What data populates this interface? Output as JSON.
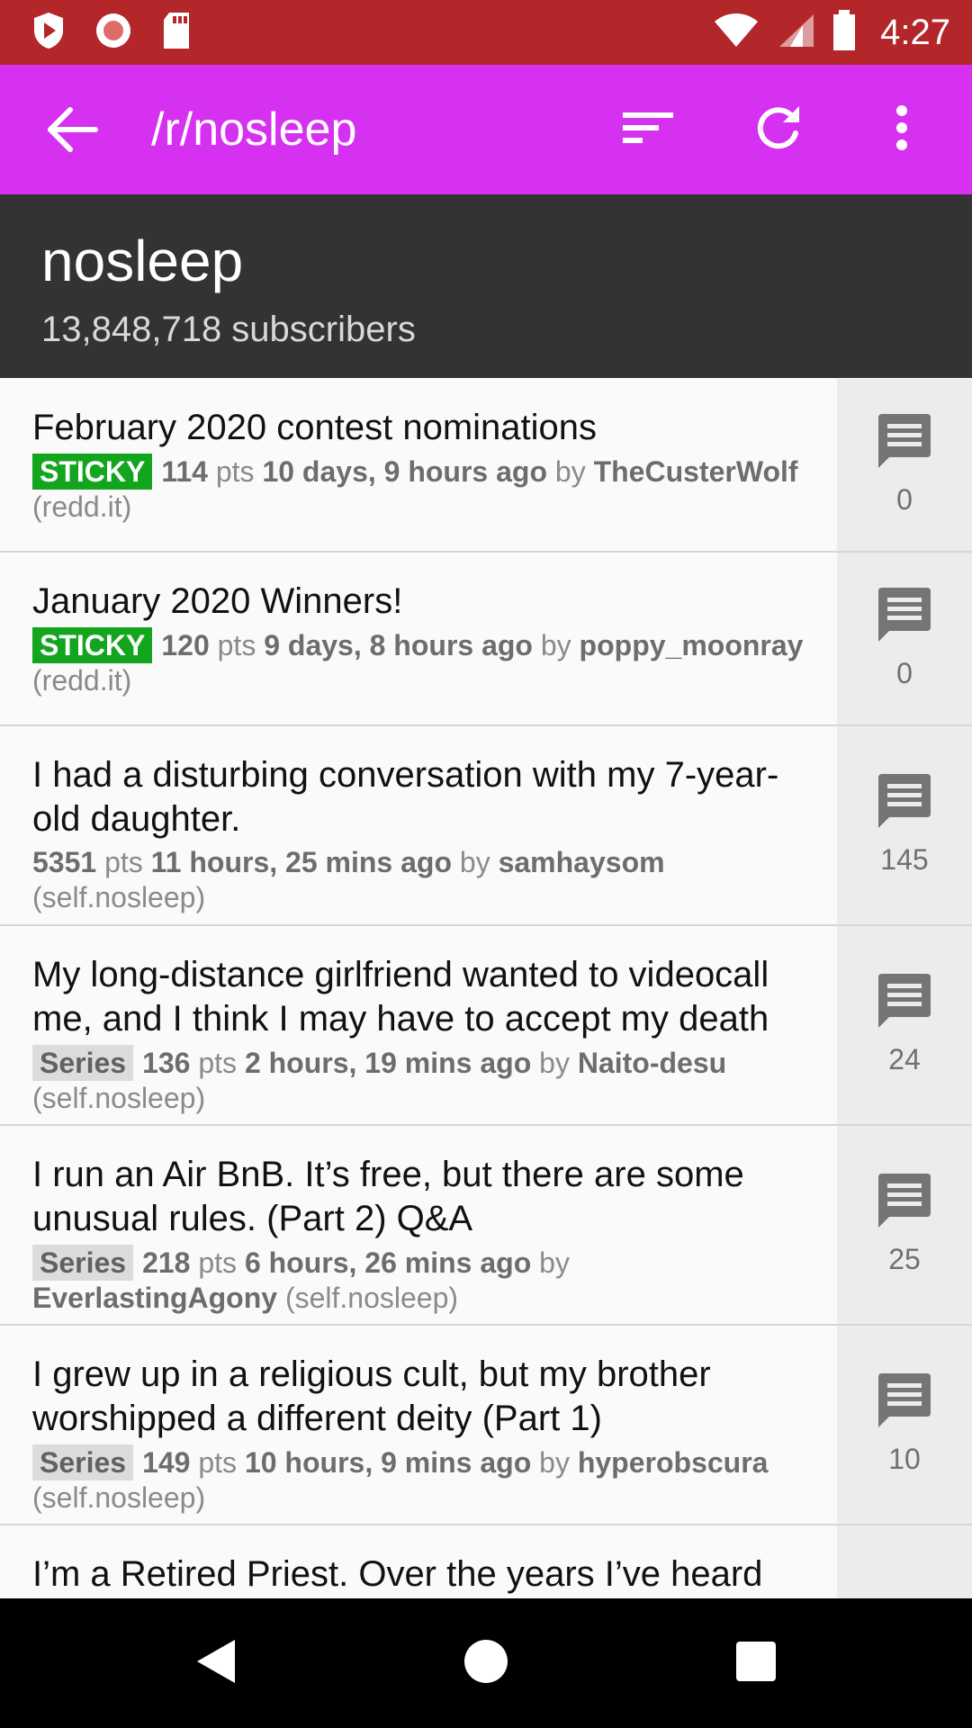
{
  "status_bar": {
    "time": "4:27"
  },
  "app_bar": {
    "title": "/r/nosleep"
  },
  "header": {
    "name": "nosleep",
    "subscribers": "13,848,718 subscribers"
  },
  "posts": [
    {
      "title": "February 2020 contest nominations",
      "tag": "STICKY",
      "points": "114",
      "pts_label": "pts",
      "time": "10 days, 9 hours ago",
      "by_label": "by",
      "author": "TheCusterWolf",
      "domain": "(redd.it)",
      "comments": "0"
    },
    {
      "title": "January 2020 Winners!",
      "tag": "STICKY",
      "points": "120",
      "pts_label": "pts",
      "time": "9 days, 8 hours ago",
      "by_label": "by",
      "author": "poppy_moonray",
      "domain": "(redd.it)",
      "comments": "0"
    },
    {
      "title": "I had a disturbing conversation with my 7-year-old daughter.",
      "tag": "",
      "points": "5351",
      "pts_label": "pts",
      "time": "11 hours, 25 mins ago",
      "by_label": "by",
      "author": "samhaysom",
      "domain": "(self.nosleep)",
      "comments": "145"
    },
    {
      "title": "My long-distance girlfriend wanted to videocall me, and I think I may have to accept my death",
      "tag": "Series",
      "points": "136",
      "pts_label": "pts",
      "time": "2 hours, 19 mins ago",
      "by_label": "by",
      "author": "Naito-desu",
      "domain": "(self.nosleep)",
      "comments": "24"
    },
    {
      "title": "I run an Air BnB. It’s free, but there are some unusual rules. (Part 2) Q&A",
      "tag": "Series",
      "points": "218",
      "pts_label": "pts",
      "time": "6 hours, 26 mins ago",
      "by_label": "by",
      "author": "EverlastingAgony",
      "domain": "(self.nosleep)",
      "comments": "25"
    },
    {
      "title": "I grew up in a religious cult, but my brother worshipped a different deity (Part 1)",
      "tag": "Series",
      "points": "149",
      "pts_label": "pts",
      "time": "10 hours, 9 mins ago",
      "by_label": "by",
      "author": "hyperobscura",
      "domain": "(self.nosleep)",
      "comments": "10"
    },
    {
      "title": "I’m a Retired Priest. Over the years I’ve heard",
      "tag": "",
      "points": "",
      "pts_label": "",
      "time": "",
      "by_label": "",
      "author": "",
      "domain": "",
      "comments": ""
    }
  ],
  "icons": {
    "back": "arrow-back-icon",
    "sort": "sort-icon",
    "refresh": "refresh-icon",
    "more": "more-vert-icon",
    "comment": "comment-icon",
    "nav_back": "nav-back-icon",
    "nav_home": "nav-home-icon",
    "nav_recents": "nav-recents-icon"
  },
  "colors": {
    "status_bar": "#b3272a",
    "app_bar": "#d630f1",
    "header": "#333333",
    "sticky": "#14a51f",
    "series": "#dcdcdc"
  }
}
